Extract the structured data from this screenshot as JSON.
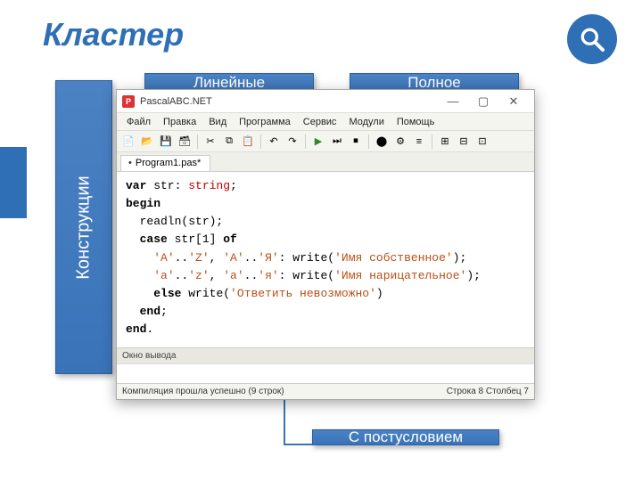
{
  "page": {
    "title": "Кластер"
  },
  "sidebar": {
    "vertical_label": "Конструкции"
  },
  "chips": {
    "top_left": "Линейные",
    "top_right": "Полное",
    "bottom": "С постусловием"
  },
  "ide": {
    "app_title": "PascalABC.NET",
    "app_icon_letter": "P",
    "menu": [
      "Файл",
      "Правка",
      "Вид",
      "Программа",
      "Сервис",
      "Модули",
      "Помощь"
    ],
    "tab": "Program1.pas*",
    "output_panel_label": "Окно вывода",
    "status_left": "Компиляция прошла успешно (9 строк)",
    "status_right": "Строка 8 Столбец 7",
    "code": {
      "l1_kw": "var",
      "l1_rest": " str: ",
      "l1_type": "string",
      "l1_end": ";",
      "l2_kw": "begin",
      "l3": "  readln(str);",
      "l4_pre": "  ",
      "l4_kw": "case",
      "l4_mid": " str[1] ",
      "l4_kw2": "of",
      "l5_pre": "    ",
      "l5_s1": "'A'",
      "l5_d": "..",
      "l5_s2": "'Z'",
      "l5_c": ", ",
      "l5_s3": "'А'",
      "l5_d2": "..",
      "l5_s4": "'Я'",
      "l5_col": ": write(",
      "l5_msg": "'Имя собственное'",
      "l5_end": ");",
      "l6_pre": "    ",
      "l6_s1": "'a'",
      "l6_d": "..",
      "l6_s2": "'z'",
      "l6_c": ", ",
      "l6_s3": "'а'",
      "l6_d2": "..",
      "l6_s4": "'я'",
      "l6_col": ": write(",
      "l6_msg": "'Имя нарицательное'",
      "l6_end": ");",
      "l7_pre": "    ",
      "l7_kw": "else",
      "l7_mid": " write(",
      "l7_msg": "'Ответить невозможно'",
      "l7_end": ")",
      "l8_pre": "  ",
      "l8_kw": "end",
      "l8_end": ";",
      "l9_kw": "end",
      "l9_end": "."
    }
  }
}
